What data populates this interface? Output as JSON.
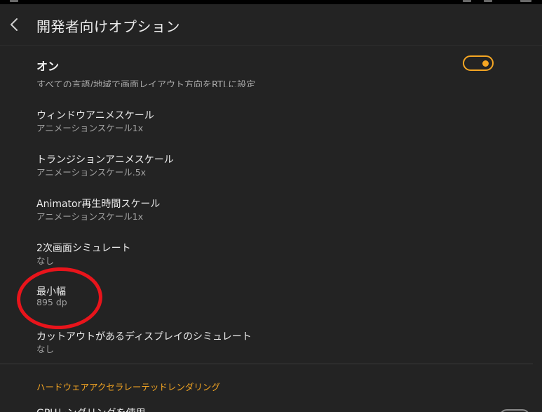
{
  "header": {
    "title": "開発者向けオプション"
  },
  "master_switch": {
    "label": "オン",
    "state": "on",
    "accent_color": "#f5a623"
  },
  "clipped_item": {
    "text": "すべての言語/地域で画面レイアウト方向をRTLに設定"
  },
  "items": [
    {
      "title": "ウィンドウアニメスケール",
      "subtitle": "アニメーションスケール1x"
    },
    {
      "title": "トランジションアニメスケール",
      "subtitle": "アニメーションスケール.5x"
    },
    {
      "title": "Animator再生時間スケール",
      "subtitle": "アニメーションスケール1x"
    },
    {
      "title": "2次画面シミュレート",
      "subtitle": "なし"
    },
    {
      "title": "最小幅",
      "subtitle": "895 dp"
    },
    {
      "title": "カットアウトがあるディスプレイのシミュレート",
      "subtitle": "なし"
    }
  ],
  "section": {
    "header": "ハードウェアアクセラレーテッドレンダリング",
    "color": "#f5a623"
  },
  "bottom_item": {
    "title": "GPUレンダリングを使用"
  },
  "annotation": {
    "color": "#e8141b"
  }
}
